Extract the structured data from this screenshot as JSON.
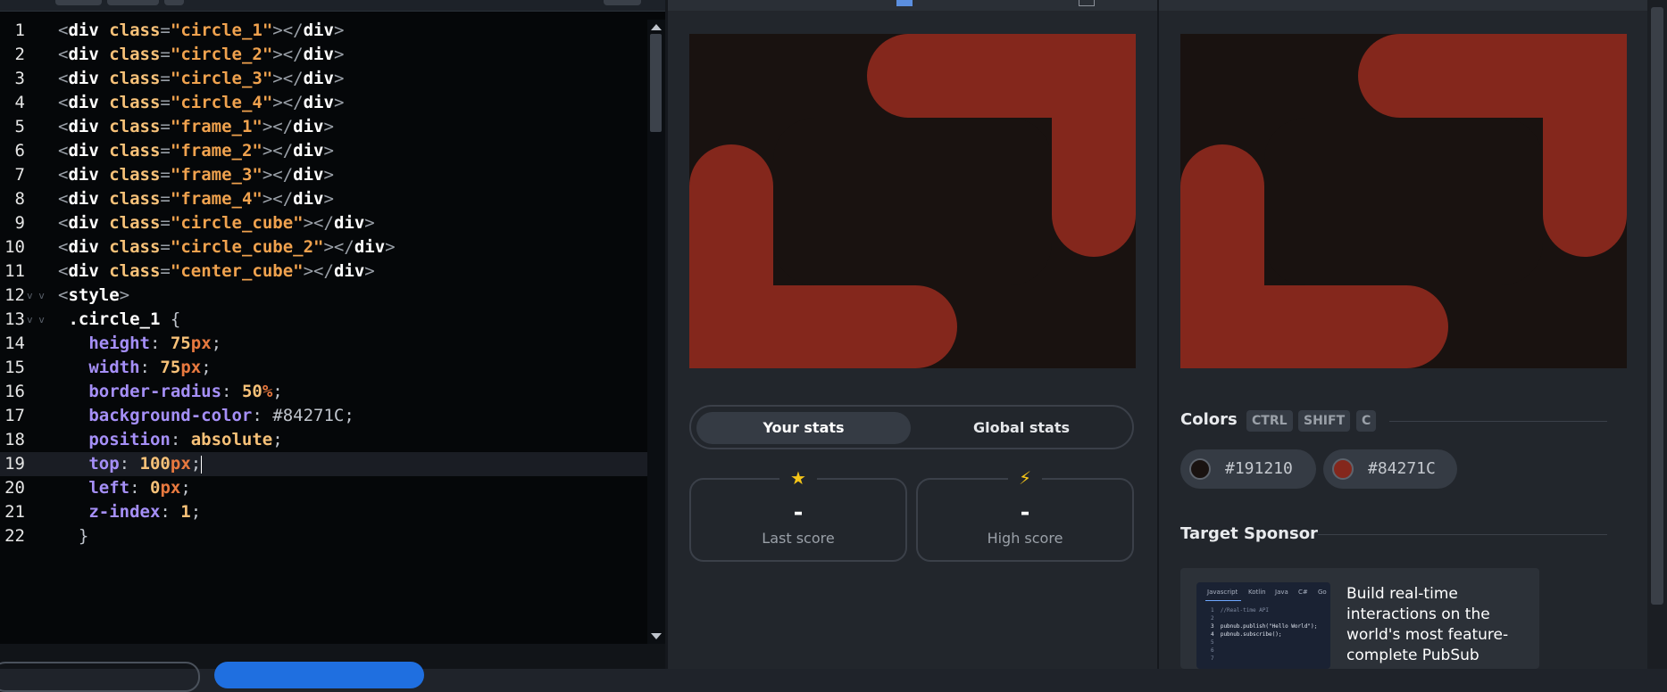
{
  "editor": {
    "lines": [
      {
        "n": "1",
        "tokens": [
          [
            "t-p",
            "<"
          ],
          [
            "t-t",
            "div "
          ],
          [
            "t-a",
            "class"
          ],
          [
            "t-p",
            "="
          ],
          [
            "t-s",
            "\"circle_1\""
          ],
          [
            "t-p",
            ">"
          ],
          [
            "t-p",
            "</"
          ],
          [
            "t-t",
            "div"
          ],
          [
            "t-p",
            ">"
          ]
        ]
      },
      {
        "n": "2",
        "tokens": [
          [
            "t-p",
            "<"
          ],
          [
            "t-t",
            "div "
          ],
          [
            "t-a",
            "class"
          ],
          [
            "t-p",
            "="
          ],
          [
            "t-s",
            "\"circle_2\""
          ],
          [
            "t-p",
            ">"
          ],
          [
            "t-p",
            "</"
          ],
          [
            "t-t",
            "div"
          ],
          [
            "t-p",
            ">"
          ]
        ]
      },
      {
        "n": "3",
        "tokens": [
          [
            "t-p",
            "<"
          ],
          [
            "t-t",
            "div "
          ],
          [
            "t-a",
            "class"
          ],
          [
            "t-p",
            "="
          ],
          [
            "t-s",
            "\"circle_3\""
          ],
          [
            "t-p",
            ">"
          ],
          [
            "t-p",
            "</"
          ],
          [
            "t-t",
            "div"
          ],
          [
            "t-p",
            ">"
          ]
        ]
      },
      {
        "n": "4",
        "tokens": [
          [
            "t-p",
            "<"
          ],
          [
            "t-t",
            "div "
          ],
          [
            "t-a",
            "class"
          ],
          [
            "t-p",
            "="
          ],
          [
            "t-s",
            "\"circle_4\""
          ],
          [
            "t-p",
            ">"
          ],
          [
            "t-p",
            "</"
          ],
          [
            "t-t",
            "div"
          ],
          [
            "t-p",
            ">"
          ]
        ]
      },
      {
        "n": "5",
        "tokens": [
          [
            "t-p",
            "<"
          ],
          [
            "t-t",
            "div "
          ],
          [
            "t-a",
            "class"
          ],
          [
            "t-p",
            "="
          ],
          [
            "t-s",
            "\"frame_1\""
          ],
          [
            "t-p",
            ">"
          ],
          [
            "t-p",
            "</"
          ],
          [
            "t-t",
            "div"
          ],
          [
            "t-p",
            ">"
          ]
        ]
      },
      {
        "n": "6",
        "tokens": [
          [
            "t-p",
            "<"
          ],
          [
            "t-t",
            "div "
          ],
          [
            "t-a",
            "class"
          ],
          [
            "t-p",
            "="
          ],
          [
            "t-s",
            "\"frame_2\""
          ],
          [
            "t-p",
            ">"
          ],
          [
            "t-p",
            "</"
          ],
          [
            "t-t",
            "div"
          ],
          [
            "t-p",
            ">"
          ]
        ]
      },
      {
        "n": "7",
        "tokens": [
          [
            "t-p",
            "<"
          ],
          [
            "t-t",
            "div "
          ],
          [
            "t-a",
            "class"
          ],
          [
            "t-p",
            "="
          ],
          [
            "t-s",
            "\"frame_3\""
          ],
          [
            "t-p",
            ">"
          ],
          [
            "t-p",
            "</"
          ],
          [
            "t-t",
            "div"
          ],
          [
            "t-p",
            ">"
          ]
        ]
      },
      {
        "n": "8",
        "tokens": [
          [
            "t-p",
            "<"
          ],
          [
            "t-t",
            "div "
          ],
          [
            "t-a",
            "class"
          ],
          [
            "t-p",
            "="
          ],
          [
            "t-s",
            "\"frame_4\""
          ],
          [
            "t-p",
            ">"
          ],
          [
            "t-p",
            "</"
          ],
          [
            "t-t",
            "div"
          ],
          [
            "t-p",
            ">"
          ]
        ]
      },
      {
        "n": "9",
        "tokens": [
          [
            "t-p",
            "<"
          ],
          [
            "t-t",
            "div "
          ],
          [
            "t-a",
            "class"
          ],
          [
            "t-p",
            "="
          ],
          [
            "t-s",
            "\"circle_cube\""
          ],
          [
            "t-p",
            ">"
          ],
          [
            "t-p",
            "</"
          ],
          [
            "t-t",
            "div"
          ],
          [
            "t-p",
            ">"
          ]
        ]
      },
      {
        "n": "10",
        "tokens": [
          [
            "t-p",
            "<"
          ],
          [
            "t-t",
            "div "
          ],
          [
            "t-a",
            "class"
          ],
          [
            "t-p",
            "="
          ],
          [
            "t-s",
            "\"circle_cube_2\""
          ],
          [
            "t-p",
            ">"
          ],
          [
            "t-p",
            "</"
          ],
          [
            "t-t",
            "div"
          ],
          [
            "t-p",
            ">"
          ]
        ]
      },
      {
        "n": "11",
        "tokens": [
          [
            "t-p",
            "<"
          ],
          [
            "t-t",
            "div "
          ],
          [
            "t-a",
            "class"
          ],
          [
            "t-p",
            "="
          ],
          [
            "t-s",
            "\"center_cube\""
          ],
          [
            "t-p",
            ">"
          ],
          [
            "t-p",
            "</"
          ],
          [
            "t-t",
            "div"
          ],
          [
            "t-p",
            ">"
          ]
        ]
      },
      {
        "n": "12",
        "fold": "v v",
        "tokens": [
          [
            "t-p",
            "<"
          ],
          [
            "t-t",
            "style"
          ],
          [
            "t-p",
            ">"
          ]
        ]
      },
      {
        "n": "13",
        "fold": "v v",
        "tokens": [
          [
            "t-c",
            " "
          ],
          [
            "t-sel",
            ".circle_1"
          ],
          [
            "t-c",
            " {"
          ]
        ]
      },
      {
        "n": "14",
        "tokens": [
          [
            "t-c",
            "   "
          ],
          [
            "t-prop",
            "height"
          ],
          [
            "t-c",
            ": "
          ],
          [
            "t-n",
            "75"
          ],
          [
            "t-u",
            "px"
          ],
          [
            "t-c",
            ";"
          ]
        ]
      },
      {
        "n": "15",
        "tokens": [
          [
            "t-c",
            "   "
          ],
          [
            "t-prop",
            "width"
          ],
          [
            "t-c",
            ": "
          ],
          [
            "t-n",
            "75"
          ],
          [
            "t-u",
            "px"
          ],
          [
            "t-c",
            ";"
          ]
        ]
      },
      {
        "n": "16",
        "tokens": [
          [
            "t-c",
            "   "
          ],
          [
            "t-prop",
            "border-radius"
          ],
          [
            "t-c",
            ": "
          ],
          [
            "t-n",
            "50"
          ],
          [
            "t-u",
            "%"
          ],
          [
            "t-c",
            ";"
          ]
        ]
      },
      {
        "n": "17",
        "tokens": [
          [
            "t-c",
            "   "
          ],
          [
            "t-prop",
            "background-color"
          ],
          [
            "t-c",
            ": "
          ],
          [
            "t-c",
            "#84271C"
          ],
          [
            "t-c",
            ";"
          ]
        ]
      },
      {
        "n": "18",
        "tokens": [
          [
            "t-c",
            "   "
          ],
          [
            "t-prop",
            "position"
          ],
          [
            "t-c",
            ": "
          ],
          [
            "t-n",
            "absolute"
          ],
          [
            "t-c",
            ";"
          ]
        ]
      },
      {
        "n": "19",
        "active": true,
        "tokens": [
          [
            "t-c",
            "   "
          ],
          [
            "t-prop",
            "top"
          ],
          [
            "t-c",
            ": "
          ],
          [
            "t-n",
            "100"
          ],
          [
            "t-u",
            "px"
          ],
          [
            "t-c",
            ";"
          ]
        ]
      },
      {
        "n": "20",
        "tokens": [
          [
            "t-c",
            "   "
          ],
          [
            "t-prop",
            "left"
          ],
          [
            "t-c",
            ": "
          ],
          [
            "t-n",
            "0"
          ],
          [
            "t-u",
            "px"
          ],
          [
            "t-c",
            ";"
          ]
        ]
      },
      {
        "n": "21",
        "tokens": [
          [
            "t-c",
            "   "
          ],
          [
            "t-prop",
            "z-index"
          ],
          [
            "t-c",
            ": "
          ],
          [
            "t-n",
            "1"
          ],
          [
            "t-c",
            ";"
          ]
        ]
      },
      {
        "n": "22",
        "tokens": [
          [
            "t-c",
            "  }"
          ]
        ]
      }
    ]
  },
  "stats": {
    "your_stats_label": "Your stats",
    "global_stats_label": "Global stats",
    "last_score_value": "-",
    "last_score_label": "Last score",
    "high_score_value": "-",
    "high_score_label": "High score",
    "star_icon": "★",
    "bolt_icon": "⚡"
  },
  "target": {
    "colors_title": "Colors",
    "shortcut_keys": [
      "CTRL",
      "SHIFT",
      "C"
    ],
    "colors": [
      {
        "hex": "#191210"
      },
      {
        "hex": "#84271C"
      }
    ],
    "sponsor_title": "Target Sponsor",
    "sponsor_text": "Build real-time interactions on the world's most feature-complete PubSub",
    "sponsor_image": {
      "tabs": [
        "Javascript",
        "Kotlin",
        "Java",
        "C#",
        "Go"
      ],
      "code": [
        [
          "1",
          "//Real-time API",
          "#7f8aa0"
        ],
        [
          "2",
          "",
          "#7f8aa0"
        ],
        [
          "3",
          "pubnub.publish(\"Hello World\");",
          "#e0e6f0"
        ],
        [
          "4",
          "pubnub.subscribe();",
          "#e0e6f0"
        ],
        [
          "5",
          "",
          "#7f8aa0"
        ],
        [
          "6",
          "",
          "#7f8aa0"
        ],
        [
          "7",
          "",
          "#7f8aa0"
        ]
      ]
    }
  },
  "theme": {
    "bg_dark": "#191210",
    "accent": "#84271C"
  }
}
